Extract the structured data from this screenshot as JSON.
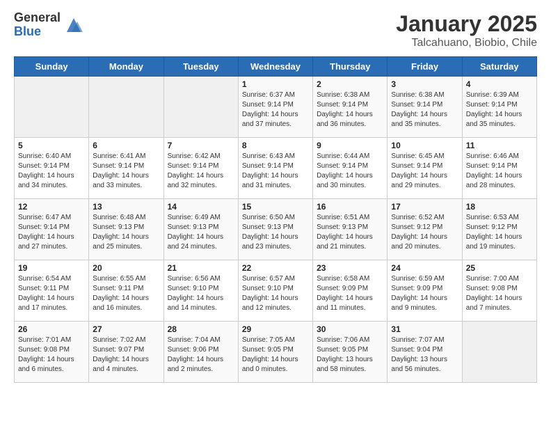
{
  "logo": {
    "general": "General",
    "blue": "Blue"
  },
  "title": "January 2025",
  "subtitle": "Talcahuano, Biobio, Chile",
  "weekdays": [
    "Sunday",
    "Monday",
    "Tuesday",
    "Wednesday",
    "Thursday",
    "Friday",
    "Saturday"
  ],
  "weeks": [
    [
      {
        "day": "",
        "text": ""
      },
      {
        "day": "",
        "text": ""
      },
      {
        "day": "",
        "text": ""
      },
      {
        "day": "1",
        "text": "Sunrise: 6:37 AM\nSunset: 9:14 PM\nDaylight: 14 hours\nand 37 minutes."
      },
      {
        "day": "2",
        "text": "Sunrise: 6:38 AM\nSunset: 9:14 PM\nDaylight: 14 hours\nand 36 minutes."
      },
      {
        "day": "3",
        "text": "Sunrise: 6:38 AM\nSunset: 9:14 PM\nDaylight: 14 hours\nand 35 minutes."
      },
      {
        "day": "4",
        "text": "Sunrise: 6:39 AM\nSunset: 9:14 PM\nDaylight: 14 hours\nand 35 minutes."
      }
    ],
    [
      {
        "day": "5",
        "text": "Sunrise: 6:40 AM\nSunset: 9:14 PM\nDaylight: 14 hours\nand 34 minutes."
      },
      {
        "day": "6",
        "text": "Sunrise: 6:41 AM\nSunset: 9:14 PM\nDaylight: 14 hours\nand 33 minutes."
      },
      {
        "day": "7",
        "text": "Sunrise: 6:42 AM\nSunset: 9:14 PM\nDaylight: 14 hours\nand 32 minutes."
      },
      {
        "day": "8",
        "text": "Sunrise: 6:43 AM\nSunset: 9:14 PM\nDaylight: 14 hours\nand 31 minutes."
      },
      {
        "day": "9",
        "text": "Sunrise: 6:44 AM\nSunset: 9:14 PM\nDaylight: 14 hours\nand 30 minutes."
      },
      {
        "day": "10",
        "text": "Sunrise: 6:45 AM\nSunset: 9:14 PM\nDaylight: 14 hours\nand 29 minutes."
      },
      {
        "day": "11",
        "text": "Sunrise: 6:46 AM\nSunset: 9:14 PM\nDaylight: 14 hours\nand 28 minutes."
      }
    ],
    [
      {
        "day": "12",
        "text": "Sunrise: 6:47 AM\nSunset: 9:14 PM\nDaylight: 14 hours\nand 27 minutes."
      },
      {
        "day": "13",
        "text": "Sunrise: 6:48 AM\nSunset: 9:13 PM\nDaylight: 14 hours\nand 25 minutes."
      },
      {
        "day": "14",
        "text": "Sunrise: 6:49 AM\nSunset: 9:13 PM\nDaylight: 14 hours\nand 24 minutes."
      },
      {
        "day": "15",
        "text": "Sunrise: 6:50 AM\nSunset: 9:13 PM\nDaylight: 14 hours\nand 23 minutes."
      },
      {
        "day": "16",
        "text": "Sunrise: 6:51 AM\nSunset: 9:13 PM\nDaylight: 14 hours\nand 21 minutes."
      },
      {
        "day": "17",
        "text": "Sunrise: 6:52 AM\nSunset: 9:12 PM\nDaylight: 14 hours\nand 20 minutes."
      },
      {
        "day": "18",
        "text": "Sunrise: 6:53 AM\nSunset: 9:12 PM\nDaylight: 14 hours\nand 19 minutes."
      }
    ],
    [
      {
        "day": "19",
        "text": "Sunrise: 6:54 AM\nSunset: 9:11 PM\nDaylight: 14 hours\nand 17 minutes."
      },
      {
        "day": "20",
        "text": "Sunrise: 6:55 AM\nSunset: 9:11 PM\nDaylight: 14 hours\nand 16 minutes."
      },
      {
        "day": "21",
        "text": "Sunrise: 6:56 AM\nSunset: 9:10 PM\nDaylight: 14 hours\nand 14 minutes."
      },
      {
        "day": "22",
        "text": "Sunrise: 6:57 AM\nSunset: 9:10 PM\nDaylight: 14 hours\nand 12 minutes."
      },
      {
        "day": "23",
        "text": "Sunrise: 6:58 AM\nSunset: 9:09 PM\nDaylight: 14 hours\nand 11 minutes."
      },
      {
        "day": "24",
        "text": "Sunrise: 6:59 AM\nSunset: 9:09 PM\nDaylight: 14 hours\nand 9 minutes."
      },
      {
        "day": "25",
        "text": "Sunrise: 7:00 AM\nSunset: 9:08 PM\nDaylight: 14 hours\nand 7 minutes."
      }
    ],
    [
      {
        "day": "26",
        "text": "Sunrise: 7:01 AM\nSunset: 9:08 PM\nDaylight: 14 hours\nand 6 minutes."
      },
      {
        "day": "27",
        "text": "Sunrise: 7:02 AM\nSunset: 9:07 PM\nDaylight: 14 hours\nand 4 minutes."
      },
      {
        "day": "28",
        "text": "Sunrise: 7:04 AM\nSunset: 9:06 PM\nDaylight: 14 hours\nand 2 minutes."
      },
      {
        "day": "29",
        "text": "Sunrise: 7:05 AM\nSunset: 9:05 PM\nDaylight: 14 hours\nand 0 minutes."
      },
      {
        "day": "30",
        "text": "Sunrise: 7:06 AM\nSunset: 9:05 PM\nDaylight: 13 hours\nand 58 minutes."
      },
      {
        "day": "31",
        "text": "Sunrise: 7:07 AM\nSunset: 9:04 PM\nDaylight: 13 hours\nand 56 minutes."
      },
      {
        "day": "",
        "text": ""
      }
    ]
  ]
}
